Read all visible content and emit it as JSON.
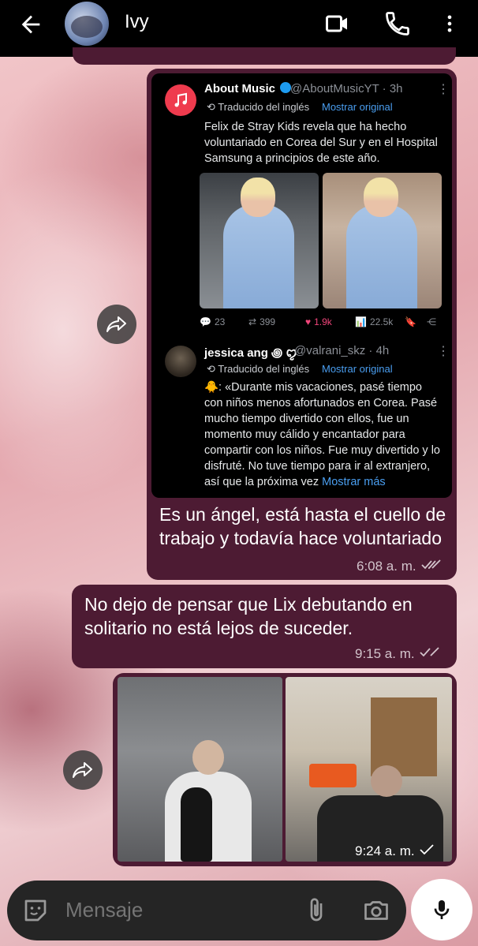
{
  "header": {
    "contact_name": "Ivy"
  },
  "tweet1": {
    "name": "About Music",
    "handle": "@AboutMusicYT · 3h",
    "translated": "Traducido del inglés",
    "show_original": "Mostrar original",
    "body": "Felix de Stray Kids revela que ha hecho voluntariado en Corea del Sur y en el Hospital Samsung a principios de este año.",
    "replies": "23",
    "retweets": "399",
    "likes": "1.9k",
    "views": "22.5k"
  },
  "tweet2": {
    "name": "jessica ang ꩜ ꨄ",
    "handle": "@valrani_skz · 4h",
    "translated": "Traducido del inglés",
    "show_original": "Mostrar original",
    "body": "🐥: «Durante mis vacaciones, pasé tiempo con niños menos afortunados en Corea. Pasé mucho tiempo divertido con ellos, fue un momento muy cálido y encantador para compartir con los niños. Fue muy divertido y lo disfruté. No tuve tiempo para ir al extranjero, así que la próxima vez ",
    "show_more": "Mostrar más"
  },
  "messages": [
    {
      "text": "Es un ángel, está hasta el cuello de trabajo y todavía hace voluntariado",
      "time": "6:08 a. m."
    },
    {
      "text": "No dejo de pensar que Lix debutando en solitario no está lejos de suceder.",
      "time": "9:15 a. m."
    },
    {
      "time": "9:24 a. m."
    }
  ],
  "input": {
    "placeholder": "Mensaje"
  },
  "colors": {
    "header_bg": "#000000",
    "bubble_bg": "#4d1b33",
    "link_blue": "#4a9ef0",
    "like_pink": "#f0457a",
    "read_check": "#d3c4cc"
  },
  "icons": [
    "back-arrow-icon",
    "video-camera-icon",
    "phone-icon",
    "more-vert-icon",
    "forward-icon",
    "sticker-icon",
    "attach-icon",
    "camera-icon",
    "mic-icon"
  ]
}
